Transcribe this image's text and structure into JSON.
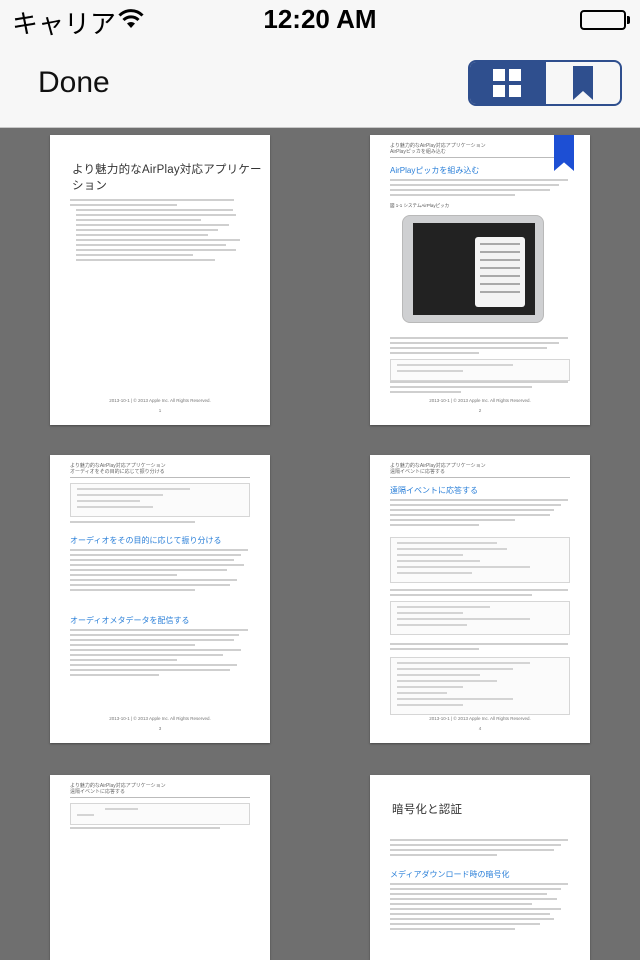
{
  "status": {
    "carrier": "キャリア",
    "time": "12:20 AM"
  },
  "nav": {
    "done_label": "Done",
    "view_modes": [
      "grid-view",
      "bookmarks-view"
    ],
    "selected_view": "grid-view",
    "accent_color": "#2f4f8e"
  },
  "pages": [
    {
      "header": "",
      "title": "より魅力的なAirPlay対応アプリケーション",
      "footer": "2013-10-1 | © 2013 Apple Inc. All Rights Reserved.",
      "page_number": "1",
      "bookmarked": false
    },
    {
      "header": "より魅力的なAirPlay対応アプリケーション",
      "header2": "AirPlayピッカを組み込む",
      "heading": "AirPlayピッカを組み込む",
      "figure_caption": "図 1-1 システムAirPlayピッカ",
      "footer": "2013-10-1 | © 2013 Apple Inc. All Rights Reserved.",
      "page_number": "2",
      "bookmarked": true,
      "bookmark_color": "#1d4fd4"
    },
    {
      "header": "より魅力的なAirPlay対応アプリケーション",
      "header2": "オーディオをその目的に応じて振り分ける",
      "heading1": "オーディオをその目的に応じて振り分ける",
      "heading2": "オーディオメタデータを配信する",
      "footer": "2013-10-1 | © 2013 Apple Inc. All Rights Reserved.",
      "page_number": "3",
      "bookmarked": false
    },
    {
      "header": "より魅力的なAirPlay対応アプリケーション",
      "header2": "遠隔イベントに応答する",
      "heading": "遠隔イベントに応答する",
      "footer": "2013-10-1 | © 2013 Apple Inc. All Rights Reserved.",
      "page_number": "4",
      "bookmarked": false
    },
    {
      "header": "より魅力的なAirPlay対応アプリケーション",
      "header2": "遠隔イベントに応答する",
      "bookmarked": false
    },
    {
      "title": "暗号化と認証",
      "heading": "メディアダウンロード時の暗号化",
      "bookmarked": false
    }
  ]
}
